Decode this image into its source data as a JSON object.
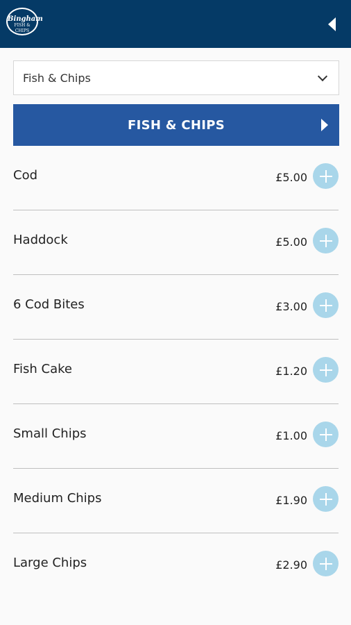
{
  "header": {
    "logo_line1": "Bingham",
    "logo_line2": "FISH & CHIPS",
    "back_icon": "back-triangle-icon",
    "background": "#053a66"
  },
  "category_select": {
    "value": "Fish & Chips"
  },
  "category_header": {
    "title": "FISH & CHIPS",
    "background": "#2658a1"
  },
  "menu_items": [
    {
      "name": "Cod",
      "price": "£5.00"
    },
    {
      "name": "Haddock",
      "price": "£5.00"
    },
    {
      "name": "6 Cod Bites",
      "price": "£3.00"
    },
    {
      "name": "Fish Cake",
      "price": "£1.20"
    },
    {
      "name": "Small Chips",
      "price": "£1.00"
    },
    {
      "name": "Medium Chips",
      "price": "£1.90"
    },
    {
      "name": "Large Chips",
      "price": "£2.90"
    }
  ],
  "colors": {
    "add_button": "#a9d6ea"
  }
}
